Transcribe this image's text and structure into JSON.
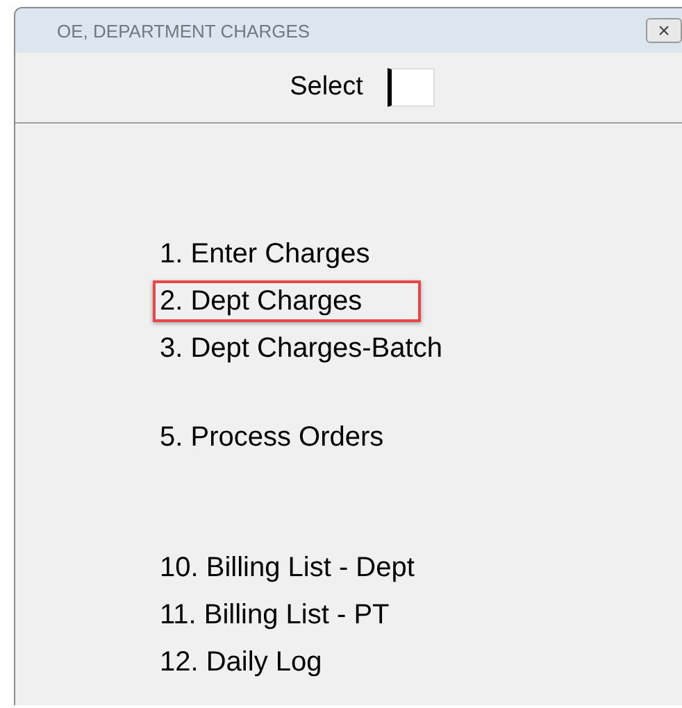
{
  "window": {
    "title": "OE, DEPARTMENT CHARGES",
    "close": "×"
  },
  "select": {
    "label": "Select"
  },
  "menu_groups": [
    {
      "items": [
        {
          "label": "1. Enter Charges",
          "highlighted": false
        },
        {
          "label": "2. Dept Charges",
          "highlighted": true
        },
        {
          "label": "3. Dept Charges-Batch",
          "highlighted": false
        }
      ]
    },
    {
      "items": [
        {
          "label": "5. Process Orders",
          "highlighted": false
        }
      ]
    },
    {
      "items": [
        {
          "label": "10. Billing List - Dept",
          "highlighted": false
        },
        {
          "label": "11. Billing List - PT",
          "highlighted": false
        },
        {
          "label": "12. Daily Log",
          "highlighted": false
        }
      ]
    }
  ]
}
